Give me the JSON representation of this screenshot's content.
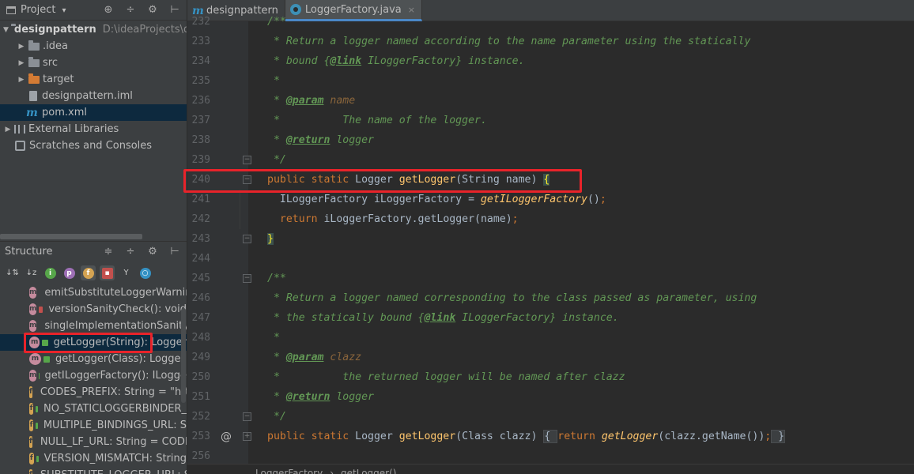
{
  "project_panel": {
    "title": "Project",
    "caret": "▾",
    "icons": [
      "globe-icon",
      "collapse-icon",
      "gear-icon",
      "hide-icon"
    ],
    "tree": [
      {
        "name": "designpattern",
        "path": "D:\\ideaProjects\\de",
        "arrow": "▼",
        "icon": "project-folder-icon"
      },
      {
        "name": ".idea",
        "arrow": "▶",
        "icon": "folder-icon"
      },
      {
        "name": "src",
        "arrow": "▶",
        "icon": "folder-icon"
      },
      {
        "name": "target",
        "arrow": "▶",
        "icon": "target-folder-icon"
      },
      {
        "name": "designpattern.iml",
        "icon": "iml-file-icon"
      },
      {
        "name": "pom.xml",
        "icon": "maven-icon",
        "selected": true
      },
      {
        "name": "External Libraries",
        "arrow": "▶",
        "icon": "library-icon"
      },
      {
        "name": "Scratches and Consoles",
        "icon": "scratch-icon"
      }
    ]
  },
  "structure_panel": {
    "title": "Structure",
    "toolbar": [
      "↓⁼",
      "↓ᶻ",
      "i",
      "p",
      "f",
      "🔒",
      "Y",
      "○"
    ],
    "items": [
      {
        "kind": "m",
        "vis": "private",
        "label": "emitSubstituteLoggerWarnin"
      },
      {
        "kind": "m",
        "vis": "private",
        "label": "versionSanityCheck(): void"
      },
      {
        "kind": "m",
        "vis": "private",
        "label": "singleImplementationSanityC"
      },
      {
        "kind": "m",
        "vis": "public",
        "label": "getLogger(String): Logger",
        "selected": true
      },
      {
        "kind": "m",
        "vis": "public",
        "label": "getLogger(Class): Logger"
      },
      {
        "kind": "m",
        "vis": "public",
        "label": "getILoggerFactory(): ILogge"
      },
      {
        "kind": "f",
        "vis": "package",
        "label": "CODES_PREFIX: String = \"htt"
      },
      {
        "kind": "f",
        "vis": "package",
        "label": "NO_STATICLOGGERBINDER_"
      },
      {
        "kind": "f",
        "vis": "package",
        "label": "MULTIPLE_BINDINGS_URL: S"
      },
      {
        "kind": "f",
        "vis": "package",
        "label": "NULL_LF_URL: String = CODE"
      },
      {
        "kind": "f",
        "vis": "package",
        "label": "VERSION_MISMATCH: String"
      },
      {
        "kind": "f",
        "vis": "package",
        "label": "SUBSTITUTE_LOGGER_URL: S"
      }
    ]
  },
  "tabs": [
    {
      "label": "designpattern",
      "icon": "maven-icon",
      "active": false
    },
    {
      "label": "LoggerFactory.java",
      "icon": "java-class-icon",
      "active": true,
      "close": "×"
    }
  ],
  "code": {
    "lines": [
      {
        "n": "232",
        "segs": [
          [
            "c-doc",
            "/**"
          ]
        ]
      },
      {
        "n": "233",
        "segs": [
          [
            "c-doc",
            " * Return a logger named according to the name parameter using the statically"
          ]
        ]
      },
      {
        "n": "234",
        "segs": [
          [
            "c-doc",
            " * bound {"
          ],
          [
            "c-link",
            "@link"
          ],
          [
            "c-doc",
            " ILoggerFactory} instance."
          ]
        ]
      },
      {
        "n": "235",
        "segs": [
          [
            "c-doc",
            " *"
          ]
        ]
      },
      {
        "n": "236",
        "segs": [
          [
            "c-doc",
            " * "
          ],
          [
            "c-tag",
            "@param"
          ],
          [
            "c-param",
            " name"
          ]
        ]
      },
      {
        "n": "237",
        "segs": [
          [
            "c-doc",
            " *          The name of the logger."
          ]
        ]
      },
      {
        "n": "238",
        "segs": [
          [
            "c-doc",
            " * "
          ],
          [
            "c-tag",
            "@return"
          ],
          [
            "c-doc",
            " logger"
          ]
        ]
      },
      {
        "n": "239",
        "segs": [
          [
            "c-doc",
            " */"
          ]
        ]
      },
      {
        "n": "240",
        "segs": [
          [
            "c-kw",
            "public static "
          ],
          [
            "",
            "Logger "
          ],
          [
            "c-fn",
            "getLogger"
          ],
          [
            "",
            "(String name) "
          ],
          [
            "c-brace-hl",
            "{"
          ]
        ]
      },
      {
        "n": "241",
        "segs": [
          [
            "",
            "  ILoggerFactory iLoggerFactory = "
          ],
          [
            "c-it",
            "getILoggerFactory"
          ],
          [
            "",
            "()"
          ],
          [
            "c-sep",
            ";"
          ]
        ]
      },
      {
        "n": "242",
        "segs": [
          [
            "c-kw",
            "  return "
          ],
          [
            "",
            "iLoggerFactory.getLogger(name)"
          ],
          [
            "c-sep",
            ";"
          ]
        ]
      },
      {
        "n": "243",
        "segs": [
          [
            "c-brace-hl",
            "}"
          ]
        ]
      },
      {
        "n": "244",
        "segs": []
      },
      {
        "n": "245",
        "segs": [
          [
            "c-doc",
            "/**"
          ]
        ]
      },
      {
        "n": "246",
        "segs": [
          [
            "c-doc",
            " * Return a logger named corresponding to the class passed as parameter, using"
          ]
        ]
      },
      {
        "n": "247",
        "segs": [
          [
            "c-doc",
            " * the statically bound {"
          ],
          [
            "c-link",
            "@link"
          ],
          [
            "c-doc",
            " ILoggerFactory} instance."
          ]
        ]
      },
      {
        "n": "248",
        "segs": [
          [
            "c-doc",
            " *"
          ]
        ]
      },
      {
        "n": "249",
        "segs": [
          [
            "c-doc",
            " * "
          ],
          [
            "c-tag",
            "@param"
          ],
          [
            "c-param",
            " clazz"
          ]
        ]
      },
      {
        "n": "250",
        "segs": [
          [
            "c-doc",
            " *          the returned logger will be named after clazz"
          ]
        ]
      },
      {
        "n": "251",
        "segs": [
          [
            "c-doc",
            " * "
          ],
          [
            "c-tag",
            "@return"
          ],
          [
            "c-doc",
            " logger"
          ]
        ]
      },
      {
        "n": "252",
        "segs": [
          [
            "c-doc",
            " */"
          ]
        ]
      },
      {
        "n": "253",
        "segs": [
          [
            "c-kw",
            "public static "
          ],
          [
            "",
            "Logger "
          ],
          [
            "c-fn",
            "getLogger"
          ],
          [
            "",
            "(Class clazz) "
          ],
          [
            "c-foldbox",
            "{ "
          ],
          [
            "c-kw",
            "return "
          ],
          [
            "c-it",
            "getLogger"
          ],
          [
            "",
            "(clazz.getName())"
          ],
          [
            "c-sep",
            ";"
          ],
          [
            "c-foldbox",
            " }"
          ]
        ]
      },
      {
        "n": "256",
        "segs": []
      }
    ]
  },
  "gutter_override_marker": "@",
  "breadcrumb": {
    "items": [
      "LoggerFactory",
      "getLogger()"
    ],
    "separator": "›"
  },
  "annotation_color": "#e8232a"
}
